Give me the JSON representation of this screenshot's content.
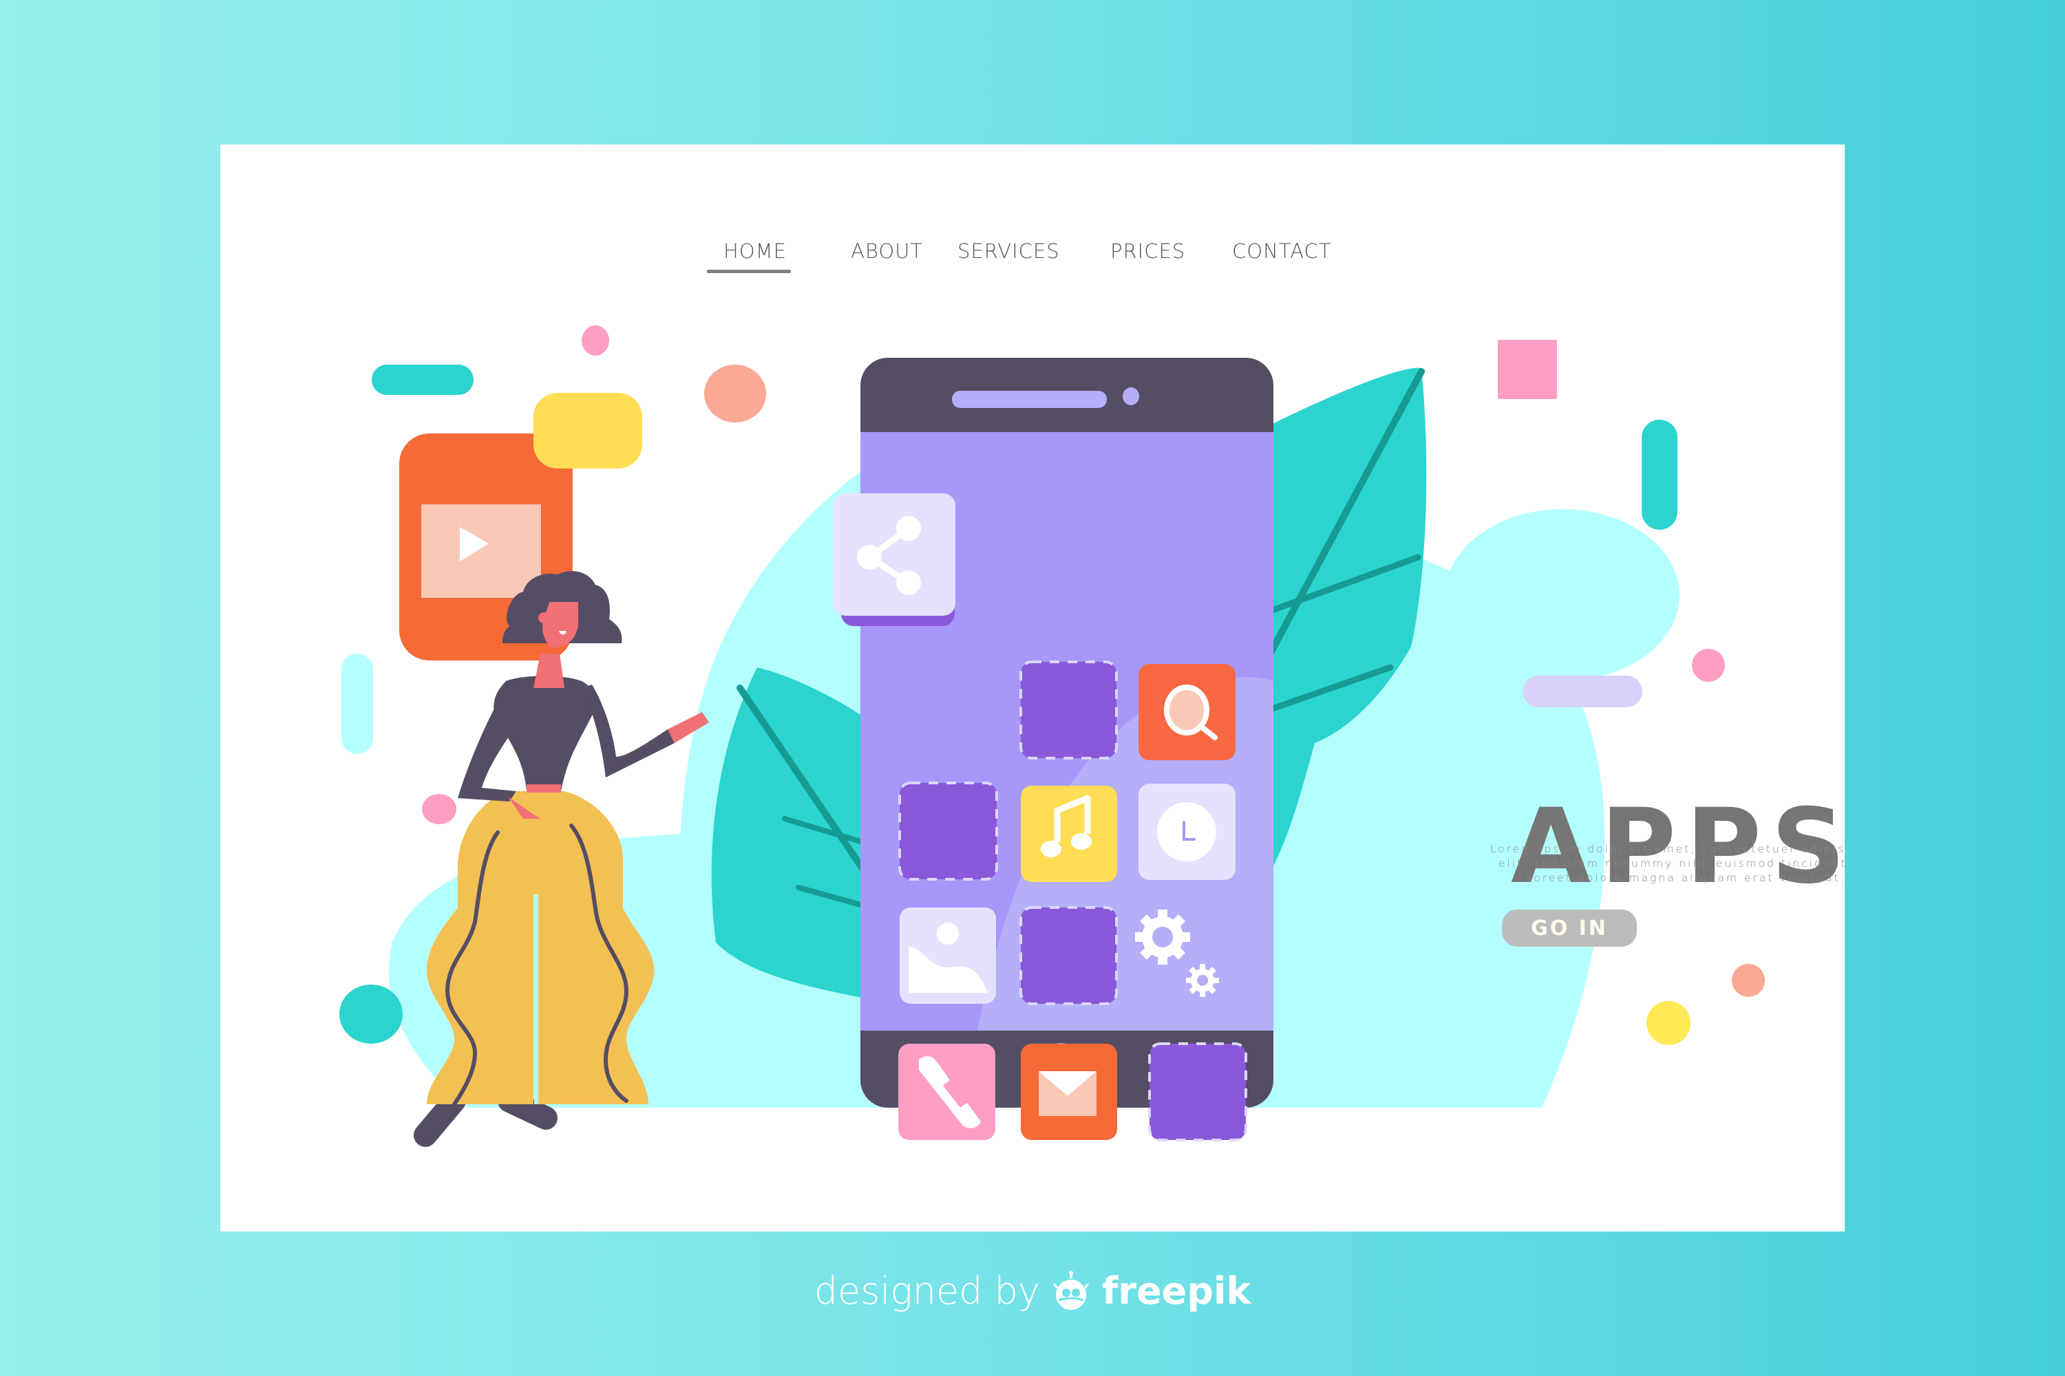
{
  "nav": {
    "items": [
      {
        "label": "HOME",
        "active": true
      },
      {
        "label": "ABOUT",
        "active": false
      },
      {
        "label": "SERVICES",
        "active": false
      },
      {
        "label": "PRICES",
        "active": false
      },
      {
        "label": "CONTACT",
        "active": false
      }
    ]
  },
  "hero": {
    "title": "APPS",
    "description_lines": [
      "Lorem ipsum dolor sit amet, consectetuer adipiscing",
      "elit, sed diam nonummy nibh euismod tincidunt ut",
      "laoreet dolore magna aliquam erat volutpat."
    ],
    "cta_label": "GO IN"
  },
  "phone": {
    "apps": [
      {
        "icon": "share-icon",
        "style": "floating"
      },
      {
        "icon": "placeholder-slot",
        "style": "dashed"
      },
      {
        "icon": "search-icon",
        "style": "app"
      },
      {
        "icon": "placeholder-slot",
        "style": "dashed"
      },
      {
        "icon": "music-note-icon",
        "style": "app"
      },
      {
        "icon": "clock-icon",
        "style": "app"
      },
      {
        "icon": "image-icon",
        "style": "app"
      },
      {
        "icon": "placeholder-slot",
        "style": "dashed"
      },
      {
        "icon": "settings-gears-icon",
        "style": "bare"
      },
      {
        "icon": "phone-call-icon",
        "style": "app"
      },
      {
        "icon": "mail-icon",
        "style": "app"
      },
      {
        "icon": "placeholder-slot",
        "style": "dashed"
      }
    ]
  },
  "floating": {
    "video_app_icon": "play-icon",
    "speech_bubble": "chat-bubble"
  },
  "footer": {
    "designed_by": "designed by",
    "brand": "freepik",
    "brand_icon": "freepik-logo-icon"
  },
  "colors": {
    "bg_gradient_start": "#97efee",
    "bg_gradient_end": "#45cfdb",
    "phone_frame": "#554d63",
    "phone_screen": "#a797f9",
    "phone_screen_light": "#b5aef9",
    "accent_purple": "#8959d9",
    "orange": "#f56a36",
    "yellow": "#ffdd55",
    "pink": "#ff9ec4",
    "teal": "#2bd4cf",
    "light_cyan": "#b4fffd",
    "peach": "#f9a994",
    "lavender": "#d6d2fc",
    "skin": "#f07074",
    "pants": "#f3c053",
    "cta_bg": "#bcbcbc",
    "title_text": "#767676"
  }
}
